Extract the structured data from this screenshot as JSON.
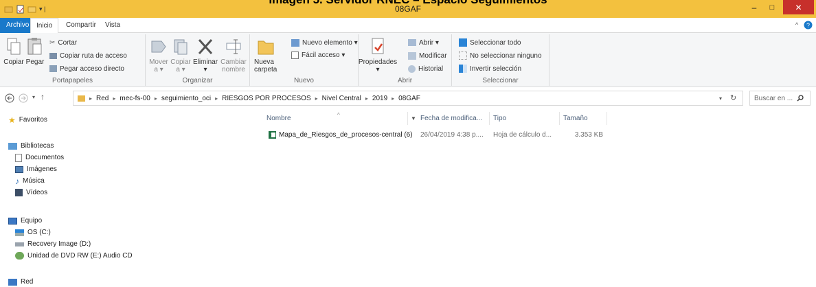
{
  "caption": "Imagen 5. Servidor RNEC – Espacio Seguimientos",
  "window": {
    "title": "08GAF",
    "minimize": "–",
    "maximize": "□",
    "close": "✕"
  },
  "tabs": {
    "file": "Archivo",
    "home": "Inicio",
    "share": "Compartir",
    "view": "Vista"
  },
  "ribbon": {
    "clipboard": {
      "copy": "Copiar",
      "paste": "Pegar",
      "cut": "Cortar",
      "copy_path": "Copiar ruta de acceso",
      "paste_shortcut": "Pegar acceso directo",
      "label": "Portapapeles"
    },
    "organize": {
      "move_to": "Mover a ▾",
      "copy_to": "Copiar a ▾",
      "delete": "Eliminar ▾",
      "rename": "Cambiar nombre",
      "label": "Organizar"
    },
    "new": {
      "new_folder": "Nueva carpeta",
      "new_item": "Nuevo elemento ▾",
      "easy_access": "Fácil acceso ▾",
      "label": "Nuevo"
    },
    "open": {
      "properties": "Propiedades ▾",
      "open": "Abrir ▾",
      "edit": "Modificar",
      "history": "Historial",
      "label": "Abrir"
    },
    "select": {
      "select_all": "Seleccionar todo",
      "select_none": "No seleccionar ninguno",
      "invert": "Invertir selección",
      "label": "Seleccionar"
    }
  },
  "address": {
    "crumbs": [
      "Red",
      "mec-fs-00",
      "seguimiento_oci",
      "RIESGOS POR PROCESOS",
      "Nivel Central",
      "2019",
      "08GAF"
    ],
    "search_placeholder": "Buscar en ..."
  },
  "nav": {
    "favorites": "Favoritos",
    "libraries": "Bibliotecas",
    "documents": "Documentos",
    "images": "Imágenes",
    "music": "Música",
    "videos": "Vídeos",
    "computer": "Equipo",
    "os": "OS (C:)",
    "recovery": "Recovery Image (D:)",
    "dvd": "Unidad de DVD RW (E:) Audio CD",
    "network": "Red"
  },
  "columns": {
    "name": "Nombre",
    "date": "Fecha de modifica...",
    "type": "Tipo",
    "size": "Tamaño"
  },
  "files": [
    {
      "name": "Mapa_de_Riesgos_de_procesos-central (6)",
      "date": "26/04/2019 4:38 p....",
      "type": "Hoja de cálculo d...",
      "size": "3.353 KB"
    }
  ],
  "colors": {
    "titlebar": "#f3c13e",
    "file_tab": "#1979ca",
    "close": "#c7302b",
    "help": "#1979ca"
  }
}
